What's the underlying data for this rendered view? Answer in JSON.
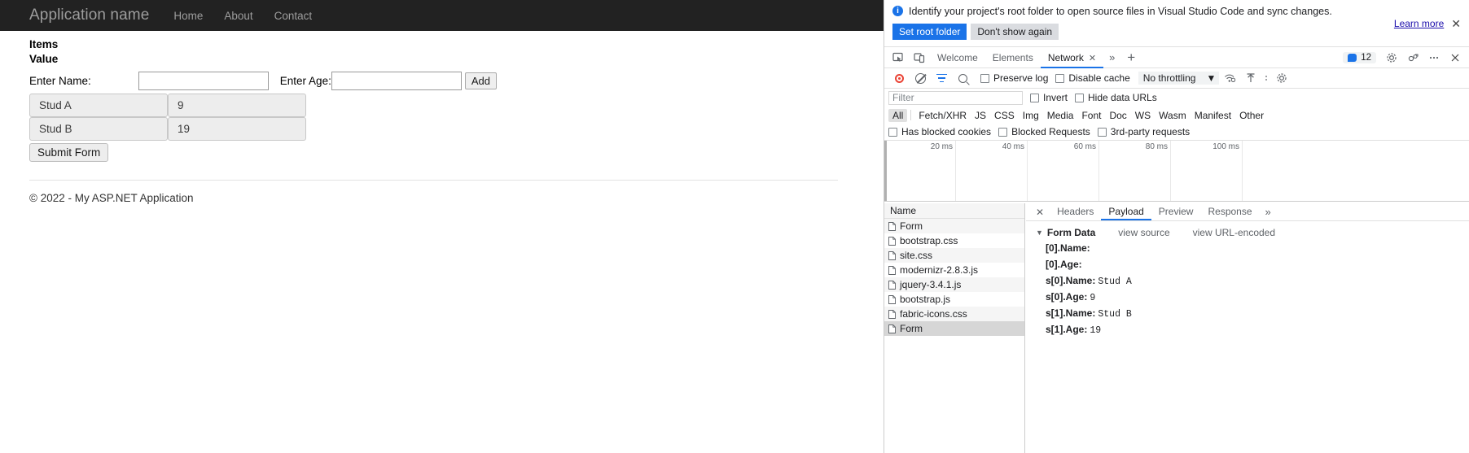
{
  "page": {
    "brand": "Application name",
    "nav": [
      "Home",
      "About",
      "Contact"
    ],
    "headers": {
      "items": "Items",
      "value": "Value"
    },
    "form": {
      "name_label": "Enter Name:",
      "name_value": "",
      "name_placeholder": "",
      "age_label": "Enter Age:",
      "age_value": "",
      "age_placeholder": "",
      "add_label": "Add",
      "submit_label": "Submit Form"
    },
    "rows": [
      {
        "name": "Stud A",
        "age": "9"
      },
      {
        "name": "Stud B",
        "age": "19"
      }
    ],
    "footer": "© 2022 - My ASP.NET Application"
  },
  "devtools": {
    "banner": {
      "icon": "info-icon",
      "message": "Identify your project's root folder to open source files in Visual Studio Code and sync changes.",
      "primary": "Set root folder",
      "secondary": "Don't show again",
      "learn_more": "Learn more",
      "close": "✕",
      "primary_color": "#1a73e8"
    },
    "tabs": {
      "items": [
        {
          "label": "Welcome",
          "active": false
        },
        {
          "label": "Elements",
          "active": false
        },
        {
          "label": "Network",
          "active": true
        }
      ],
      "close_glyph": "✕",
      "more_glyph": "»",
      "add_glyph": "+",
      "issues_count": "12",
      "settings_icon": "gear-icon",
      "customize_icon": "more-options-icon",
      "close_icon": "close-icon",
      "inspect_icon": "inspect-element-icon",
      "device_icon": "device-toolbar-icon",
      "accent_color": "#1a73e8"
    },
    "controls": {
      "record_icon": "record-icon",
      "clear_icon": "clear-icon",
      "filter_icon": "filter-icon",
      "search_icon": "search-icon",
      "preserve_log": "Preserve log",
      "disable_cache": "Disable cache",
      "throttling": "No throttling",
      "caret": "▼",
      "wifi_icon": "network-conditions-icon",
      "import_icon": "import-har-icon",
      "export_icon": "export-har-icon",
      "settings_icon": "network-settings-icon"
    },
    "filter": {
      "placeholder": "Filter",
      "value": "",
      "invert": "Invert",
      "hide_data_urls": "Hide data URLs",
      "types": [
        "All",
        "Fetch/XHR",
        "JS",
        "CSS",
        "Img",
        "Media",
        "Font",
        "Doc",
        "WS",
        "Wasm",
        "Manifest",
        "Other"
      ],
      "active_type": "All",
      "has_blocked_cookies": "Has blocked cookies",
      "blocked_requests": "Blocked Requests",
      "third_party": "3rd-party requests"
    },
    "timeline": {
      "ticks": [
        "20 ms",
        "40 ms",
        "60 ms",
        "80 ms",
        "100 ms"
      ]
    },
    "requests": {
      "column": "Name",
      "items": [
        {
          "name": "Form",
          "selected": false
        },
        {
          "name": "bootstrap.css",
          "selected": false
        },
        {
          "name": "site.css",
          "selected": false
        },
        {
          "name": "modernizr-2.8.3.js",
          "selected": false
        },
        {
          "name": "jquery-3.4.1.js",
          "selected": false
        },
        {
          "name": "bootstrap.js",
          "selected": false
        },
        {
          "name": "fabric-icons.css",
          "selected": false
        },
        {
          "name": "Form",
          "selected": true
        }
      ]
    },
    "detail": {
      "close_glyph": "✕",
      "tabs": [
        {
          "label": "Headers",
          "active": false
        },
        {
          "label": "Payload",
          "active": true
        },
        {
          "label": "Preview",
          "active": false
        },
        {
          "label": "Response",
          "active": false
        }
      ],
      "more_glyph": "»",
      "payload": {
        "triangle": "▼",
        "title": "Form Data",
        "view_source": "view source",
        "view_url_encoded": "view URL-encoded",
        "entries": [
          {
            "key": "[0].Name:",
            "value": ""
          },
          {
            "key": "[0].Age:",
            "value": ""
          },
          {
            "key": "s[0].Name:",
            "value": "Stud A"
          },
          {
            "key": "s[0].Age:",
            "value": "9"
          },
          {
            "key": "s[1].Name:",
            "value": "Stud B"
          },
          {
            "key": "s[1].Age:",
            "value": "19"
          }
        ]
      }
    }
  }
}
